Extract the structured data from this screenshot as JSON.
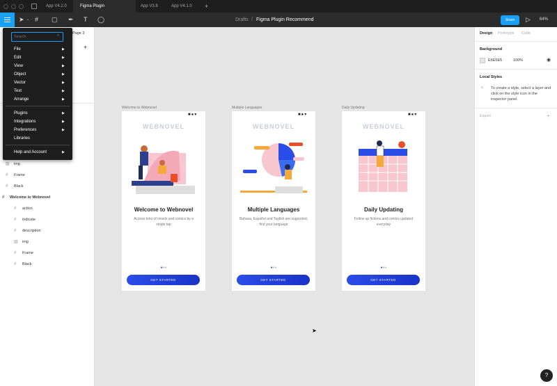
{
  "tabs": [
    "App V4.2.0",
    "Figma Plugin Recommend",
    "App V3.8",
    "App V4.1.0"
  ],
  "toolbar": {
    "breadcrumb_parent": "Drafts",
    "separator": "/",
    "file_name": "Figma Plugin Recommend",
    "share_label": "Share",
    "zoom": "64%"
  },
  "left": {
    "page_label": "Page 3"
  },
  "menu": {
    "search_placeholder": "Search",
    "group1": [
      "File",
      "Edit",
      "View",
      "Object",
      "Vector",
      "Text",
      "Arrange"
    ],
    "group2": [
      "Plugins",
      "Integrations",
      "Preferences",
      "Libraries"
    ],
    "group3": [
      "Help and Account"
    ]
  },
  "layers": {
    "group_a": [
      "img",
      "Frame",
      "Black"
    ],
    "parent": "Welcome to Webnovel",
    "group_b": [
      "action",
      "indicate",
      "description",
      "img",
      "Frame",
      "Black"
    ]
  },
  "frames": [
    {
      "label": "Welcome to Webnovel",
      "logo": "WEBNOVEL",
      "title": "Welcome to Webnovel",
      "desc": "Access tons of novels and comics by a single tap",
      "cta": "GET STARTED",
      "active_dot": 0
    },
    {
      "label": "Multiple Languages",
      "logo": "WEBNOVEL",
      "title": "Multiple Languages",
      "desc": "Bahasa, Español and Tagllsh are supported, find your language",
      "cta": "GET STARTED",
      "active_dot": 0
    },
    {
      "label": "Daily Updating",
      "logo": "WEBNOVEL",
      "title": "Daily Updating",
      "desc": "Follow up fictions and comics updated everyday",
      "cta": "GET STARTED",
      "active_dot": 0
    }
  ],
  "right": {
    "tabs": [
      "Design",
      "Prototype",
      "Code"
    ],
    "background_title": "Background",
    "bg_hex": "E5E5E5",
    "bg_opacity": "100%",
    "local_styles_title": "Local Styles",
    "local_styles_hint": "To create a style, select a layer and click on the style icon in the inspector panel.",
    "export_title": "Export"
  },
  "help_label": "?",
  "colors": {
    "accent": "#18a0fb",
    "cta": "#2a4de8",
    "canvas": "#e5e5e5"
  }
}
